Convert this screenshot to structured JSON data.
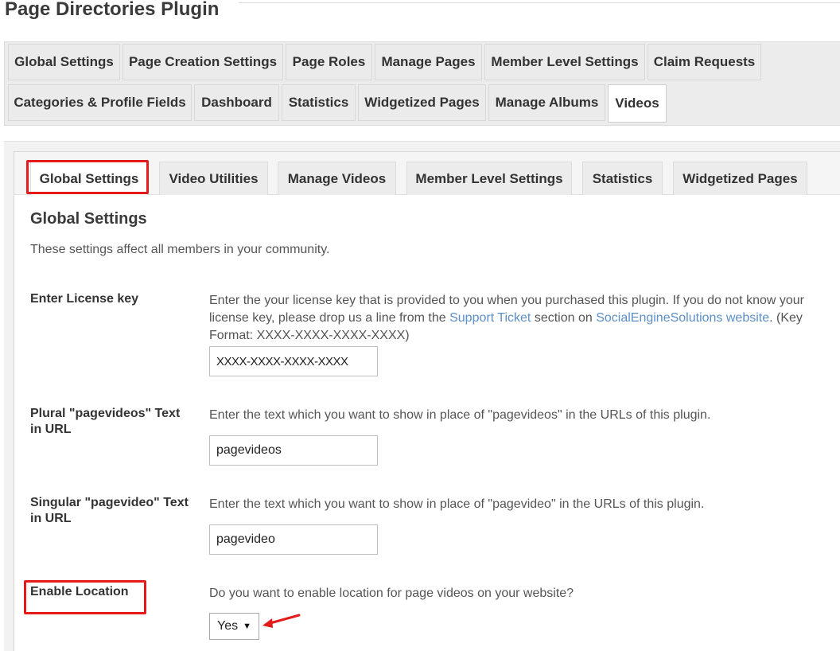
{
  "page": {
    "title": "Page Directories Plugin"
  },
  "main_tabs": [
    {
      "label": "Global Settings"
    },
    {
      "label": "Page Creation Settings"
    },
    {
      "label": "Page Roles"
    },
    {
      "label": "Manage Pages"
    },
    {
      "label": "Member Level Settings"
    },
    {
      "label": "Claim Requests"
    },
    {
      "label": "Categories & Profile Fields"
    },
    {
      "label": "Dashboard"
    },
    {
      "label": "Statistics"
    },
    {
      "label": "Widgetized Pages"
    },
    {
      "label": "Manage Albums"
    },
    {
      "label": "Videos"
    }
  ],
  "sub_tabs": [
    {
      "label": "Global Settings"
    },
    {
      "label": "Video Utilities"
    },
    {
      "label": "Manage Videos"
    },
    {
      "label": "Member Level Settings"
    },
    {
      "label": "Statistics"
    },
    {
      "label": "Widgetized Pages"
    }
  ],
  "section": {
    "title": "Global Settings",
    "description": "These settings affect all members in your community."
  },
  "fields": {
    "license": {
      "label": "Enter License key",
      "desc_part1": "Enter the your license key that is provided to you when you purchased this plugin. If you do not know your license key, please drop us a line from the ",
      "link1": "Support Ticket",
      "desc_part2": " section on ",
      "link2": "SocialEngineSolutions website",
      "desc_part3": ". (Key Format: XXXX-XXXX-XXXX-XXXX)",
      "value": "XXXX-XXXX-XXXX-XXXX"
    },
    "plural": {
      "label": "Plural \"pagevideos\" Text in URL",
      "desc": "Enter the text which you want to show in place of \"pagevideos\" in the URLs of this plugin.",
      "value": "pagevideos"
    },
    "singular": {
      "label": "Singular \"pagevideo\" Text in URL",
      "desc": "Enter the text which you want to show in place of \"pagevideo\" in the URLs of this plugin.",
      "value": "pagevideo"
    },
    "location": {
      "label": "Enable Location",
      "desc": "Do you want to enable location for page videos on your website?",
      "selected": "Yes",
      "caret": "▼"
    }
  },
  "colors": {
    "highlight": "#e41b1b",
    "link": "#5b8fc7"
  }
}
